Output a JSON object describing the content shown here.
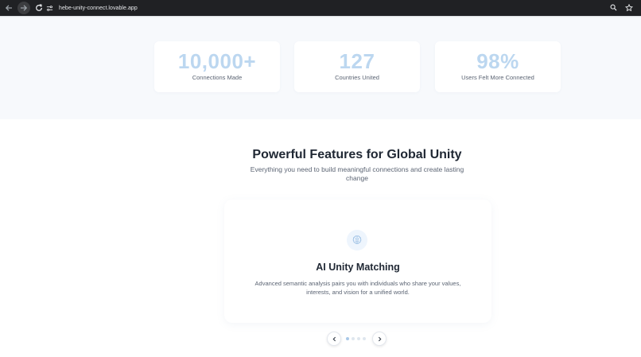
{
  "browser": {
    "url": "hebe-unity-connect.lovable.app",
    "icons": [
      "back-arrow-icon",
      "forward-arrow-icon",
      "reload-icon",
      "site-settings-icon",
      "search-icon",
      "bookmark-star-icon"
    ]
  },
  "stats": [
    {
      "value": "10,000+",
      "label": "Connections Made"
    },
    {
      "value": "127",
      "label": "Countries United"
    },
    {
      "value": "98%",
      "label": "Users Felt More Connected"
    }
  ],
  "features": {
    "title": "Powerful Features for Global Unity",
    "subtitle": "Everything you need to build meaningful connections and create lasting change",
    "active_card": {
      "icon": "brain-icon",
      "title": "AI Unity Matching",
      "description": "Advanced semantic analysis pairs you with individuals who share your values, interests, and vision for a unified world."
    },
    "carousel": {
      "slide_count": 4,
      "active_index": 0
    }
  },
  "colors": {
    "stat_number": "#bcd7f0",
    "heading": "#1f2733",
    "body_text": "#5b6473",
    "chrome_bg": "#202124",
    "section_bg": "#f7f9fc"
  }
}
